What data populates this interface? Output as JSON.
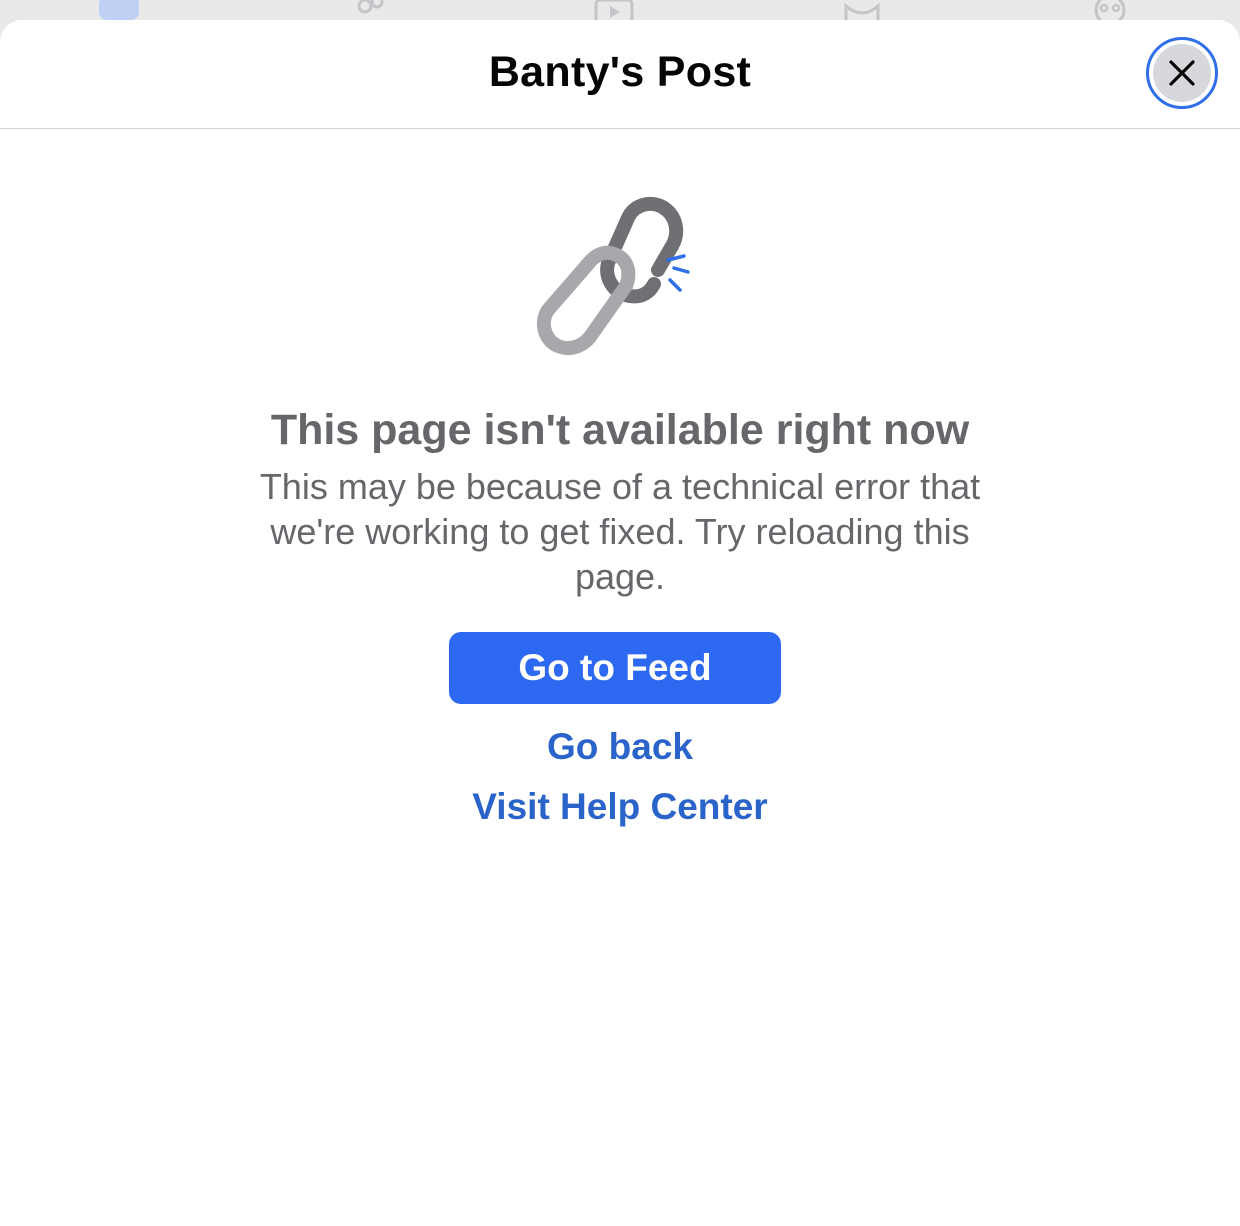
{
  "tab_bar": {
    "icons": [
      "home-icon",
      "friends-icon",
      "video-icon",
      "marketplace-icon",
      "groups-icon"
    ]
  },
  "sheet": {
    "title": "Banty's Post",
    "close_icon": "close-icon"
  },
  "error": {
    "icon": "broken-link-icon",
    "heading": "This page isn't available right now",
    "body": "This may be because of a technical error that we're working to get fixed. Try reloading this page."
  },
  "actions": {
    "primary_label": "Go to Feed",
    "go_back_label": "Go back",
    "help_label": "Visit Help Center"
  },
  "colors": {
    "accent": "#2d68f0",
    "link": "#2a63c9",
    "muted_text": "#65676b",
    "focus_ring": "#2f6fea"
  }
}
